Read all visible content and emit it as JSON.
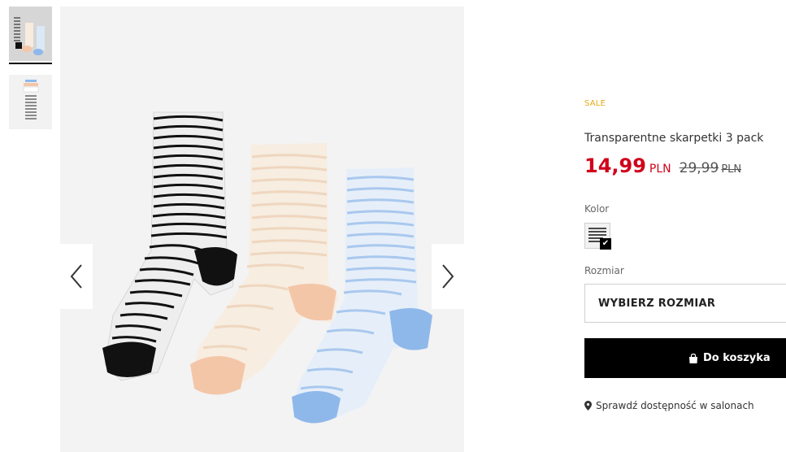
{
  "gallery": {
    "thumbnails": [
      {
        "alt": "3 pack socks front"
      },
      {
        "alt": "3 pack socks packaging"
      }
    ],
    "prev_icon": "chevron-left-icon",
    "next_icon": "chevron-right-icon",
    "sock_colors": [
      "#111111",
      "#f4c6a8",
      "#8fb8ea"
    ]
  },
  "product": {
    "badge": "SALE",
    "badge_color": "#e6a915",
    "title": "Transparentne skarpetki 3 pack",
    "price_new": "14,99",
    "currency_new": "PLN",
    "price_old": "29,99",
    "currency_old": "PLN",
    "price_color": "#d0021b",
    "color_label": "Kolor",
    "size_label": "Rozmiar",
    "size_placeholder": "WYBIERZ ROZMIAR",
    "cart_button": "Do koszyka",
    "cart_icon": "shopping-bag-icon",
    "availability_link": "Sprawdź dostępność w salonach",
    "availability_icon": "map-pin-icon"
  }
}
